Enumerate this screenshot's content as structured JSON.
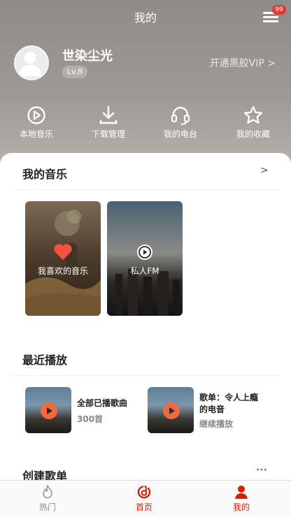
{
  "header": {
    "title": "我的",
    "badge_count": "99"
  },
  "profile": {
    "username": "世染尘光",
    "level": "Lv.8",
    "vip_link": "开通黑胶VIP >"
  },
  "quick_actions": [
    {
      "label": "本地音乐",
      "icon": "play-circle-icon"
    },
    {
      "label": "下载管理",
      "icon": "download-icon"
    },
    {
      "label": "我的电台",
      "icon": "headphones-icon"
    },
    {
      "label": "我的收藏",
      "icon": "star-icon"
    }
  ],
  "my_music": {
    "title": "我的音乐",
    "arrow": ">",
    "tiles": [
      {
        "label": "我喜欢的音乐",
        "icon": "heart-icon"
      },
      {
        "label": "私人FM",
        "icon": "play-circle-icon"
      }
    ]
  },
  "recent": {
    "title": "最近播放",
    "items": [
      {
        "title": "全部已播歌曲",
        "subtitle": "300首"
      },
      {
        "title": "歌单：令人上瘾的电音",
        "subtitle": "继续播放"
      }
    ]
  },
  "created_playlists": {
    "title": "创建歌单",
    "more": "···"
  },
  "tabbar": {
    "tabs": [
      {
        "label": "热门",
        "icon": "flame-icon",
        "active": false
      },
      {
        "label": "首页",
        "icon": "netease-logo-icon",
        "active": false
      },
      {
        "label": "我的",
        "icon": "user-icon",
        "active": true
      }
    ],
    "active_color": "#d81e06"
  },
  "colors": {
    "accent": "#d81e06",
    "header_bg": "#9a9892",
    "badge": "#e53935"
  }
}
